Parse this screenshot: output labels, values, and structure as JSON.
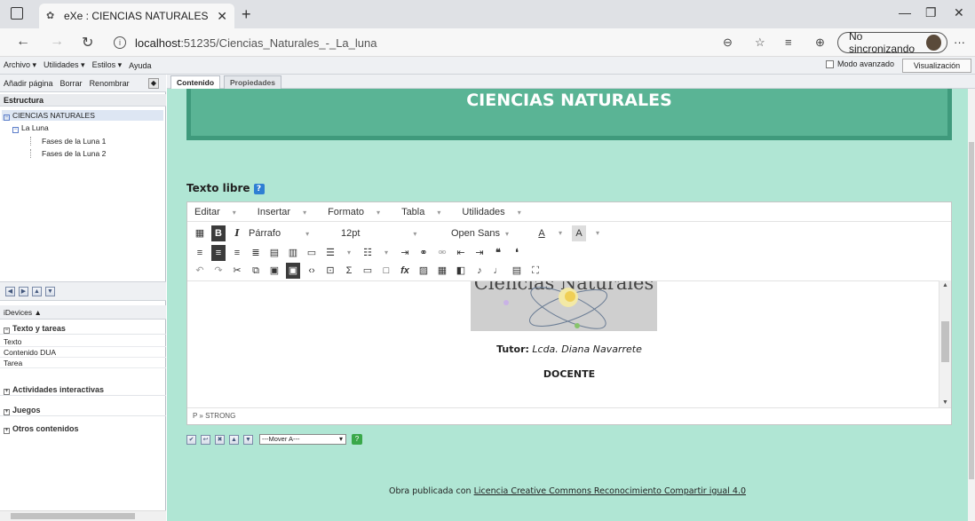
{
  "browser": {
    "tab_title": "eXe : CIENCIAS NATURALES",
    "url_host": "localhost",
    "url_path": ":51235/Ciencias_Naturales_-_La_luna",
    "sync_label": "No sincronizando"
  },
  "menu": [
    "Archivo ▾",
    "Utilidades ▾",
    "Estilos ▾",
    "Ayuda"
  ],
  "modo_avanzado": "Modo avanzado",
  "visualizacion_previa": "Visualización previa",
  "left": {
    "tools": [
      "Añadir página",
      "Borrar",
      "Renombrar"
    ],
    "structure_title": "Estructura",
    "tree": {
      "root": "CIENCIAS NATURALES",
      "child": "La Luna",
      "leaves": [
        "Fases de la Luna 1",
        "Fases de la Luna 2"
      ]
    },
    "idevices_title": "iDevices ▲",
    "categories": {
      "texto": "Texto y tareas",
      "actividades": "Actividades interactivas",
      "juegos": "Juegos",
      "otros": "Otros contenidos"
    },
    "texto_items": [
      "Texto",
      "Contenido DUA",
      "Tarea"
    ]
  },
  "main": {
    "tabs": [
      "Contenido",
      "Propiedades"
    ],
    "header_title": "CIENCIAS NATURALES",
    "idevice_title": "Texto libre",
    "editor_menu": [
      "Editar",
      "Insertar",
      "Formato",
      "Tabla",
      "Utilidades"
    ],
    "format_select": "Párrafo",
    "size_select": "12pt",
    "font_select": "Open Sans",
    "logo_text": "Ciencias Naturales",
    "tutor_label": "Tutor:",
    "tutor_name": "Lcda. Diana Navarrete",
    "docente": "DOCENTE",
    "status_path": "P » STRONG",
    "move_select": "---Mover A---",
    "footer_prefix": "Obra publicada con ",
    "footer_link": "Licencia Creative Commons Reconocimiento Compartir igual 4.0"
  }
}
